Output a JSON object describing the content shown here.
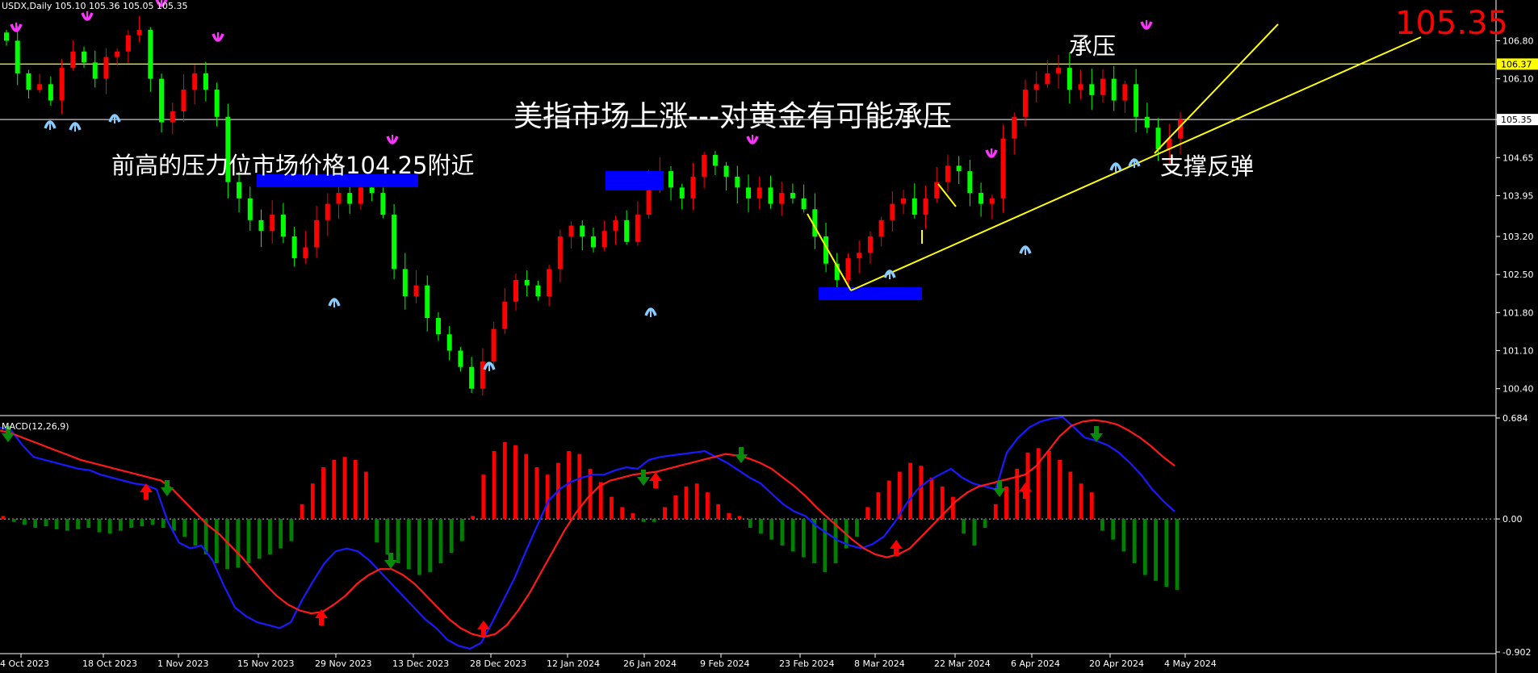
{
  "header": {
    "symbol_label": "USDX,Daily",
    "ohlc_label": "105.10 105.36 105.05 105.35"
  },
  "chart_data": [
    {
      "type": "candlestick",
      "title": "USDX,Daily",
      "y_ticks": [
        "106.80",
        "106.10",
        "105.35",
        "104.65",
        "103.95",
        "103.20",
        "102.50",
        "101.80",
        "101.10",
        "100.40"
      ],
      "ylim": [
        99.95,
        107.4
      ],
      "x_ticks": [
        "4 Oct 2023",
        "18 Oct 2023",
        "1 Nov 2023",
        "15 Nov 2023",
        "29 Nov 2023",
        "13 Dec 2023",
        "28 Dec 2023",
        "12 Jan 2024",
        "26 Jan 2024",
        "9 Feb 2024",
        "23 Feb 2024",
        "8 Mar 2024",
        "22 Mar 2024",
        "6 Apr 2024",
        "20 Apr 2024",
        "4 May 2024"
      ],
      "horizontal_lines": [
        {
          "value": 106.37,
          "label": "106.37",
          "color": "#ffff00"
        },
        {
          "value": 105.35,
          "label": "105.35",
          "color": "#c8c8c8"
        }
      ],
      "close_path": [
        106.8,
        106.2,
        105.9,
        106.0,
        105.7,
        106.3,
        106.6,
        106.4,
        106.1,
        106.5,
        106.6,
        106.9,
        107.0,
        106.1,
        105.3,
        105.5,
        105.9,
        106.2,
        105.9,
        105.4,
        104.2,
        103.9,
        103.5,
        103.3,
        103.6,
        103.2,
        102.8,
        103.0,
        103.5,
        103.8,
        104.0,
        103.8,
        104.1,
        104.0,
        103.6,
        102.6,
        102.1,
        102.3,
        101.7,
        101.4,
        101.1,
        100.8,
        100.4,
        100.9,
        101.5,
        102.0,
        102.4,
        102.3,
        102.1,
        102.6,
        103.2,
        103.4,
        103.2,
        103.0,
        103.3,
        103.5,
        103.1,
        103.6,
        104.2,
        104.4,
        104.1,
        103.9,
        104.3,
        104.7,
        104.5,
        104.3,
        104.1,
        103.9,
        104.1,
        103.8,
        104.0,
        103.9,
        103.7,
        103.2,
        102.7,
        102.4,
        102.8,
        102.9,
        103.2,
        103.5,
        103.8,
        103.9,
        103.6,
        103.9,
        104.2,
        104.5,
        104.4,
        104.0,
        103.8,
        103.9,
        105.0,
        105.4,
        105.9,
        106.0,
        106.2,
        106.3,
        105.9,
        106.0,
        105.8,
        106.1,
        105.7,
        106.0,
        105.4,
        105.2,
        104.8,
        105.0,
        105.35
      ],
      "annotations": [
        {
          "text": "前高的压力位市场价格104.25附近"
        },
        {
          "text": "美指市场上涨---对黄金有可能承压"
        },
        {
          "text": "承压"
        },
        {
          "text": "支撑反弹"
        },
        {
          "text": "105.35",
          "color": "#ff0000"
        }
      ]
    },
    {
      "type": "bar",
      "title": "MACD(12,26,9)",
      "y_ticks": [
        "0.684",
        "0.00",
        "-0.902"
      ],
      "ylim": [
        -0.902,
        0.684
      ],
      "series": [
        {
          "name": "histogram",
          "colors": {
            "positive": "#ff0000",
            "negative": "#008000"
          },
          "values": [
            0.02,
            -0.02,
            -0.04,
            -0.06,
            -0.05,
            -0.07,
            -0.08,
            -0.07,
            -0.06,
            -0.09,
            -0.1,
            -0.08,
            -0.06,
            -0.05,
            -0.04,
            -0.06,
            -0.08,
            -0.12,
            -0.18,
            -0.24,
            -0.3,
            -0.34,
            -0.33,
            -0.3,
            -0.27,
            -0.24,
            -0.2,
            -0.15,
            0.1,
            0.24,
            0.35,
            0.4,
            0.42,
            0.4,
            0.32,
            -0.16,
            -0.24,
            -0.3,
            -0.34,
            -0.38,
            -0.36,
            -0.3,
            -0.23,
            -0.15,
            0.02,
            0.3,
            0.46,
            0.52,
            0.5,
            0.44,
            0.35,
            0.3,
            0.38,
            0.46,
            0.44,
            0.34,
            0.25,
            0.15,
            0.08,
            0.04,
            -0.02,
            -0.02,
            0.08,
            0.16,
            0.22,
            0.24,
            0.18,
            0.1,
            0.04,
            0.02,
            -0.06,
            -0.1,
            -0.14,
            -0.18,
            -0.22,
            -0.26,
            -0.3,
            -0.36,
            -0.3,
            -0.2,
            -0.12,
            0.08,
            0.18,
            0.26,
            0.32,
            0.38,
            0.36,
            0.28,
            0.22,
            0.15,
            -0.1,
            -0.18,
            -0.06,
            0.1,
            0.22,
            0.34,
            0.45,
            0.48,
            0.46,
            0.4,
            0.32,
            0.24,
            0.18,
            -0.08,
            -0.14,
            -0.22,
            -0.3,
            -0.38,
            -0.42,
            -0.46,
            -0.48
          ]
        },
        {
          "name": "MACD",
          "color": "#1a1aff",
          "values": [
            0.62,
            0.6,
            0.5,
            0.42,
            0.4,
            0.38,
            0.36,
            0.34,
            0.33,
            0.3,
            0.28,
            0.26,
            0.24,
            0.23,
            0.2,
            -0.02,
            -0.16,
            -0.2,
            -0.18,
            -0.28,
            -0.45,
            -0.6,
            -0.66,
            -0.7,
            -0.72,
            -0.74,
            -0.7,
            -0.55,
            -0.42,
            -0.3,
            -0.22,
            -0.2,
            -0.22,
            -0.28,
            -0.36,
            -0.44,
            -0.52,
            -0.6,
            -0.68,
            -0.74,
            -0.82,
            -0.86,
            -0.88,
            -0.84,
            -0.7,
            -0.55,
            -0.4,
            -0.22,
            -0.05,
            0.12,
            0.2,
            0.25,
            0.28,
            0.3,
            0.3,
            0.33,
            0.35,
            0.34,
            0.4,
            0.42,
            0.43,
            0.44,
            0.45,
            0.46,
            0.42,
            0.38,
            0.33,
            0.28,
            0.24,
            0.17,
            0.1,
            0.05,
            0.02,
            -0.05,
            -0.1,
            -0.15,
            -0.18,
            -0.2,
            -0.17,
            -0.12,
            -0.02,
            0.1,
            0.2,
            0.26,
            0.3,
            0.34,
            0.28,
            0.24,
            0.22,
            0.2,
            0.45,
            0.55,
            0.62,
            0.66,
            0.68,
            0.69,
            0.62,
            0.55,
            0.53,
            0.5,
            0.45,
            0.38,
            0.3,
            0.2,
            0.12,
            0.05
          ]
        },
        {
          "name": "Signal",
          "color": "#ff1a1a",
          "values": [
            0.6,
            0.58,
            0.55,
            0.52,
            0.49,
            0.46,
            0.43,
            0.4,
            0.38,
            0.36,
            0.34,
            0.32,
            0.3,
            0.28,
            0.26,
            0.2,
            0.12,
            0.04,
            -0.04,
            -0.1,
            -0.18,
            -0.26,
            -0.35,
            -0.44,
            -0.52,
            -0.58,
            -0.62,
            -0.64,
            -0.63,
            -0.58,
            -0.52,
            -0.44,
            -0.38,
            -0.34,
            -0.34,
            -0.38,
            -0.44,
            -0.52,
            -0.6,
            -0.68,
            -0.74,
            -0.78,
            -0.8,
            -0.78,
            -0.72,
            -0.62,
            -0.5,
            -0.36,
            -0.22,
            -0.08,
            0.04,
            0.14,
            0.22,
            0.26,
            0.28,
            0.3,
            0.31,
            0.32,
            0.34,
            0.36,
            0.38,
            0.4,
            0.42,
            0.44,
            0.43,
            0.41,
            0.38,
            0.34,
            0.28,
            0.22,
            0.15,
            0.07,
            0.0,
            -0.07,
            -0.14,
            -0.2,
            -0.24,
            -0.26,
            -0.24,
            -0.2,
            -0.12,
            -0.04,
            0.04,
            0.12,
            0.18,
            0.22,
            0.24,
            0.26,
            0.28,
            0.3,
            0.36,
            0.46,
            0.56,
            0.63,
            0.66,
            0.67,
            0.66,
            0.64,
            0.6,
            0.55,
            0.49,
            0.42,
            0.36
          ]
        }
      ]
    }
  ]
}
